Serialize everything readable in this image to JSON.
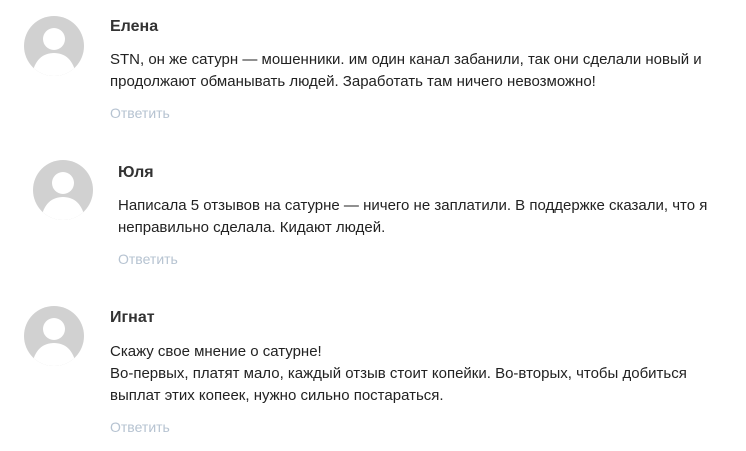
{
  "comments": [
    {
      "author": "Елена",
      "text_lines": [
        "STN, он же сатурн — мошенники. им один канал забанили, так они сделали новый и продолжают обманывать людей. Заработать там ничего невозможно!"
      ],
      "reply_label": "Ответить"
    },
    {
      "author": "Юля",
      "text_lines": [
        "Написала 5 отзывов на сатурне — ничего не заплатили. В поддержке сказали, что я неправильно сделала. Кидают людей."
      ],
      "reply_label": "Ответить"
    },
    {
      "author": "Игнат",
      "text_lines": [
        "Скажу свое мнение о сатурне!",
        "Во-первых, платят мало, каждый отзыв стоит копейки. Во-вторых, чтобы добиться выплат этих копеек, нужно сильно постараться."
      ],
      "reply_label": "Ответить"
    }
  ],
  "icons": {
    "avatar": "user-silhouette-icon"
  },
  "colors": {
    "avatar_bg": "#d1d1d1",
    "avatar_fg": "#ffffff",
    "author": "#333333",
    "text": "#222222",
    "reply_link": "#b6c3d1"
  }
}
